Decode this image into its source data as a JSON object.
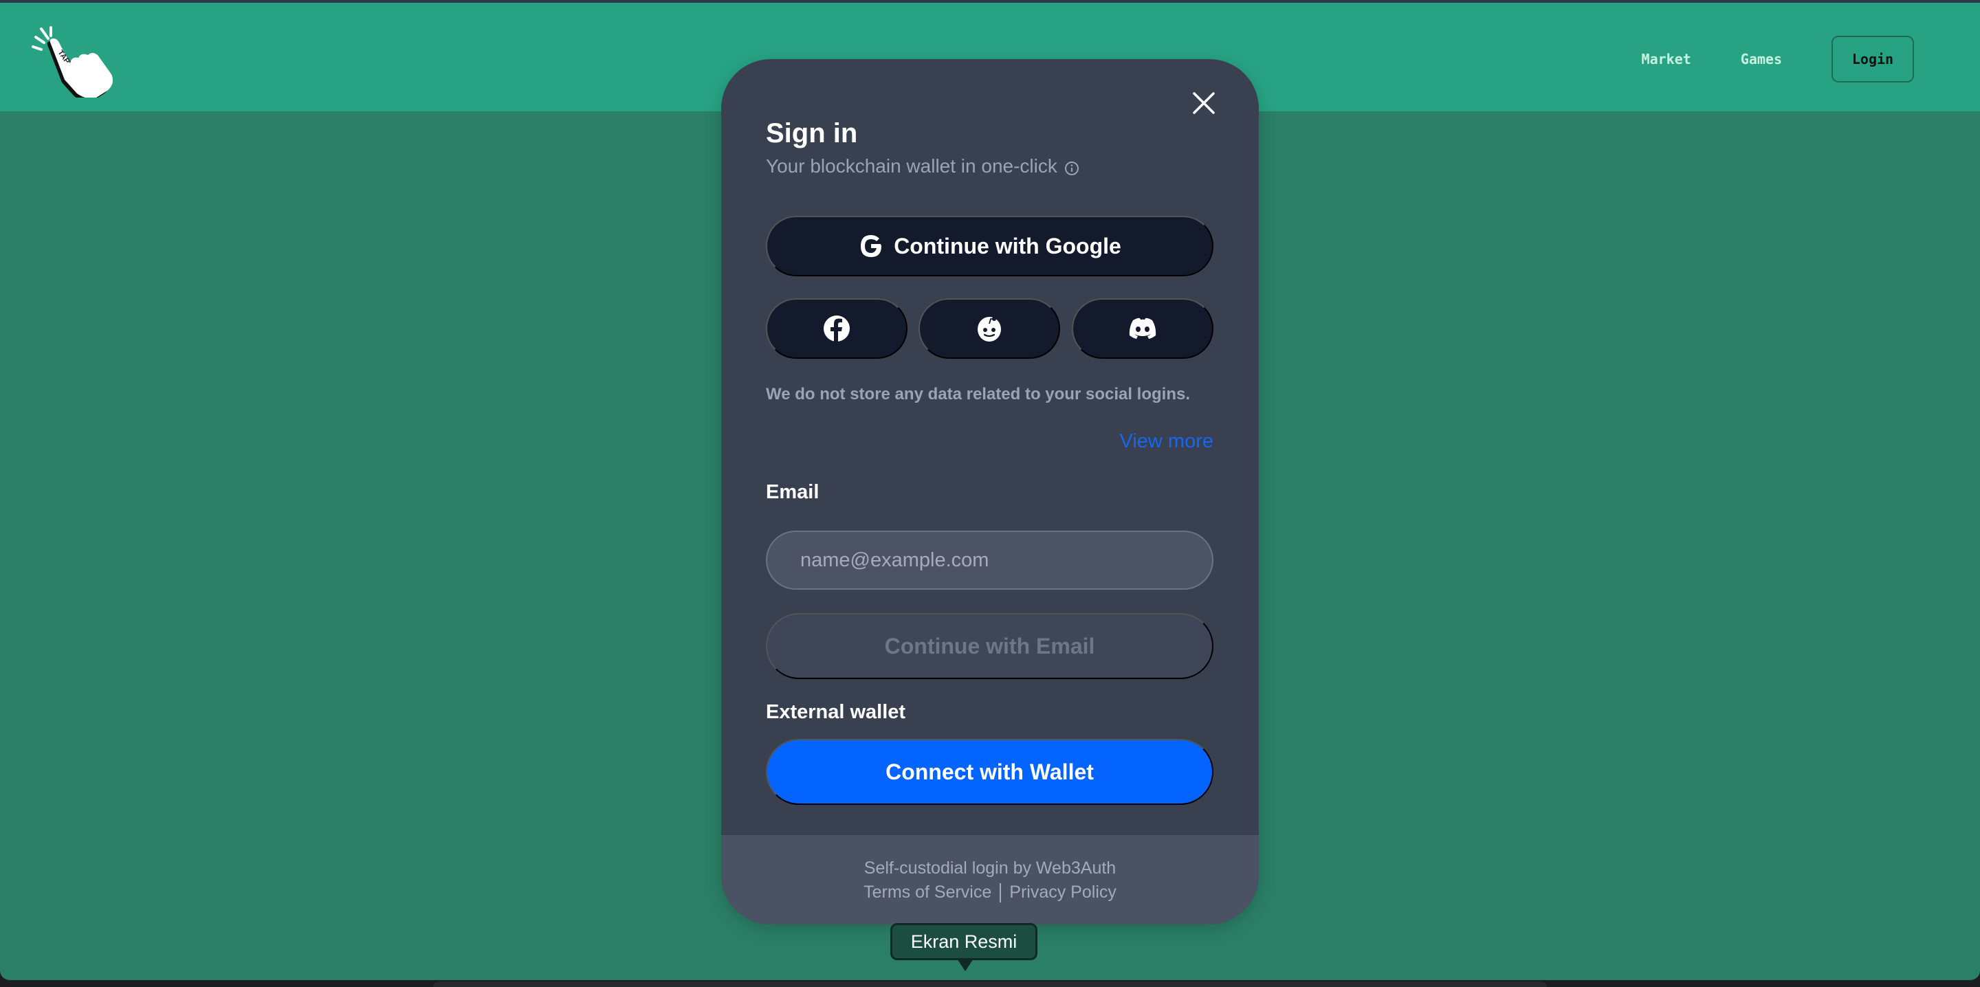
{
  "app": {
    "logo_icon": "tap-hand-icon",
    "logo_text": "TAP"
  },
  "nav": {
    "items": [
      {
        "label": "Market"
      },
      {
        "label": "Games"
      }
    ],
    "login_label": "Login"
  },
  "modal": {
    "title": "Sign in",
    "subtitle": "Your blockchain wallet in one-click",
    "subtitle_icon": "info-icon",
    "close_icon": "close-icon",
    "google_label": "Continue with Google",
    "google_icon": "google-icon",
    "social_buttons": [
      {
        "icon": "facebook-icon",
        "label": "Facebook"
      },
      {
        "icon": "reddit-icon",
        "label": "Reddit"
      },
      {
        "icon": "discord-icon",
        "label": "Discord"
      }
    ],
    "note": "We do not store any data related to your social logins.",
    "view_more": "View more",
    "email_label": "Email",
    "email_value": "",
    "email_placeholder": "name@example.com",
    "continue_email_label": "Continue with Email",
    "external_wallet_label": "External wallet",
    "connect_wallet_label": "Connect with Wallet",
    "footer": {
      "powered_by": "Self-custodial login by Web3Auth",
      "terms": "Terms of Service",
      "privacy": "Privacy Policy"
    }
  },
  "tooltip": {
    "text": "Ekran Resmi"
  },
  "colors": {
    "header_bg": "#27a383",
    "page_bg": "#2b7f66",
    "modal_bg": "#394150",
    "button_dark": "#121a2b",
    "accent_blue": "#0364ff",
    "link_blue": "#1567f0"
  }
}
